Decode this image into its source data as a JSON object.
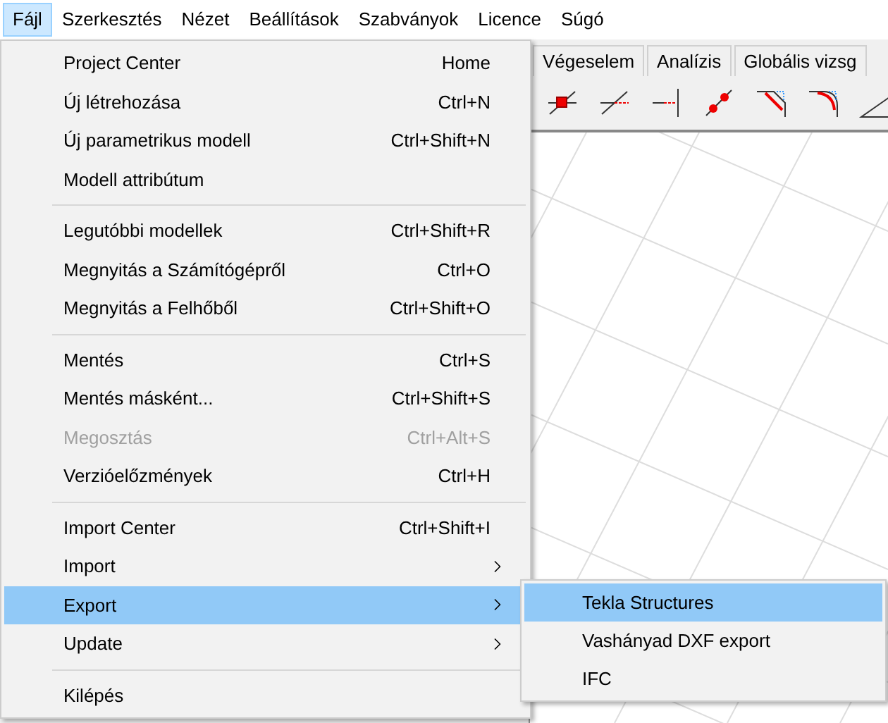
{
  "menubar": [
    {
      "label": "Fájl",
      "selected": true
    },
    {
      "label": "Szerkesztés",
      "selected": false
    },
    {
      "label": "Nézet",
      "selected": false
    },
    {
      "label": "Beállítások",
      "selected": false
    },
    {
      "label": "Szabványok",
      "selected": false
    },
    {
      "label": "Licence",
      "selected": false
    },
    {
      "label": "Súgó",
      "selected": false
    }
  ],
  "tabs": [
    {
      "label": "Végeselem",
      "selected": false
    },
    {
      "label": "Analízis",
      "selected": false
    },
    {
      "label": "Globális vizsg",
      "selected": false
    }
  ],
  "file_menu": {
    "groups": [
      [
        {
          "label": "Project Center",
          "shortcut": "Home",
          "disabled": false,
          "submenu": false,
          "selected": false
        },
        {
          "label": "Új létrehozása",
          "shortcut": "Ctrl+N",
          "disabled": false,
          "submenu": false,
          "selected": false
        },
        {
          "label": "Új parametrikus modell",
          "shortcut": "Ctrl+Shift+N",
          "disabled": false,
          "submenu": false,
          "selected": false
        },
        {
          "label": "Modell attribútum",
          "disabled": false,
          "submenu": false,
          "selected": false
        }
      ],
      [
        {
          "label": "Legutóbbi modellek",
          "shortcut": "Ctrl+Shift+R",
          "disabled": false,
          "submenu": false,
          "selected": false
        },
        {
          "label": "Megnyitás a Számítógépről",
          "shortcut": "Ctrl+O",
          "disabled": false,
          "submenu": false,
          "selected": false
        },
        {
          "label": "Megnyitás a Felhőből",
          "shortcut": "Ctrl+Shift+O",
          "disabled": false,
          "submenu": false,
          "selected": false
        }
      ],
      [
        {
          "label": "Mentés",
          "shortcut": "Ctrl+S",
          "disabled": false,
          "submenu": false,
          "selected": false
        },
        {
          "label": "Mentés másként...",
          "shortcut": "Ctrl+Shift+S",
          "disabled": false,
          "submenu": false,
          "selected": false
        },
        {
          "label": "Megosztás",
          "shortcut": "Ctrl+Alt+S",
          "disabled": true,
          "submenu": false,
          "selected": false
        },
        {
          "label": "Verzióelőzmények",
          "shortcut": "Ctrl+H",
          "disabled": false,
          "submenu": false,
          "selected": false
        }
      ],
      [
        {
          "label": "Import Center",
          "shortcut": "Ctrl+Shift+I",
          "disabled": false,
          "submenu": false,
          "selected": false
        },
        {
          "label": "Import",
          "disabled": false,
          "submenu": true,
          "selected": false
        },
        {
          "label": "Export",
          "disabled": false,
          "submenu": true,
          "selected": true
        },
        {
          "label": "Update",
          "disabled": false,
          "submenu": true,
          "selected": false
        }
      ],
      [
        {
          "label": "Kilépés",
          "disabled": false,
          "submenu": false,
          "selected": false
        }
      ]
    ]
  },
  "export_submenu": {
    "items": [
      {
        "label": "Tekla Structures",
        "selected": true
      },
      {
        "label": "Vashányad DXF export",
        "selected": false
      },
      {
        "label": "IFC",
        "selected": false
      }
    ]
  }
}
